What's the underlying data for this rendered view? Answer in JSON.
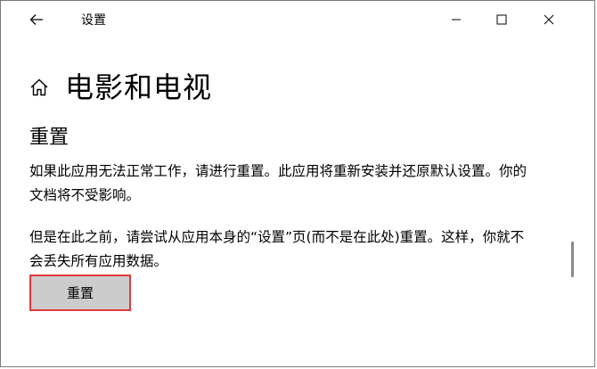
{
  "window": {
    "title": "设置"
  },
  "header": {
    "title": "电影和电视"
  },
  "section": {
    "title": "重置",
    "paragraph1": "如果此应用无法正常工作，请进行重置。此应用将重新安装并还原默认设置。你的文档将不受影响。",
    "paragraph2": "但是在此之前，请尝试从应用本身的“设置”页(而不是在此处)重置。这样，你就不会丢失所有应用数据。",
    "reset_button_label": "重置"
  },
  "icons": {
    "back": "back-arrow-icon",
    "home": "home-icon",
    "minimize": "minimize-icon",
    "maximize": "maximize-icon",
    "close": "close-icon"
  },
  "colors": {
    "button_background": "#cccccc",
    "button_highlight_border": "#e0393e",
    "scrollbar_thumb": "#8a8a8a"
  }
}
